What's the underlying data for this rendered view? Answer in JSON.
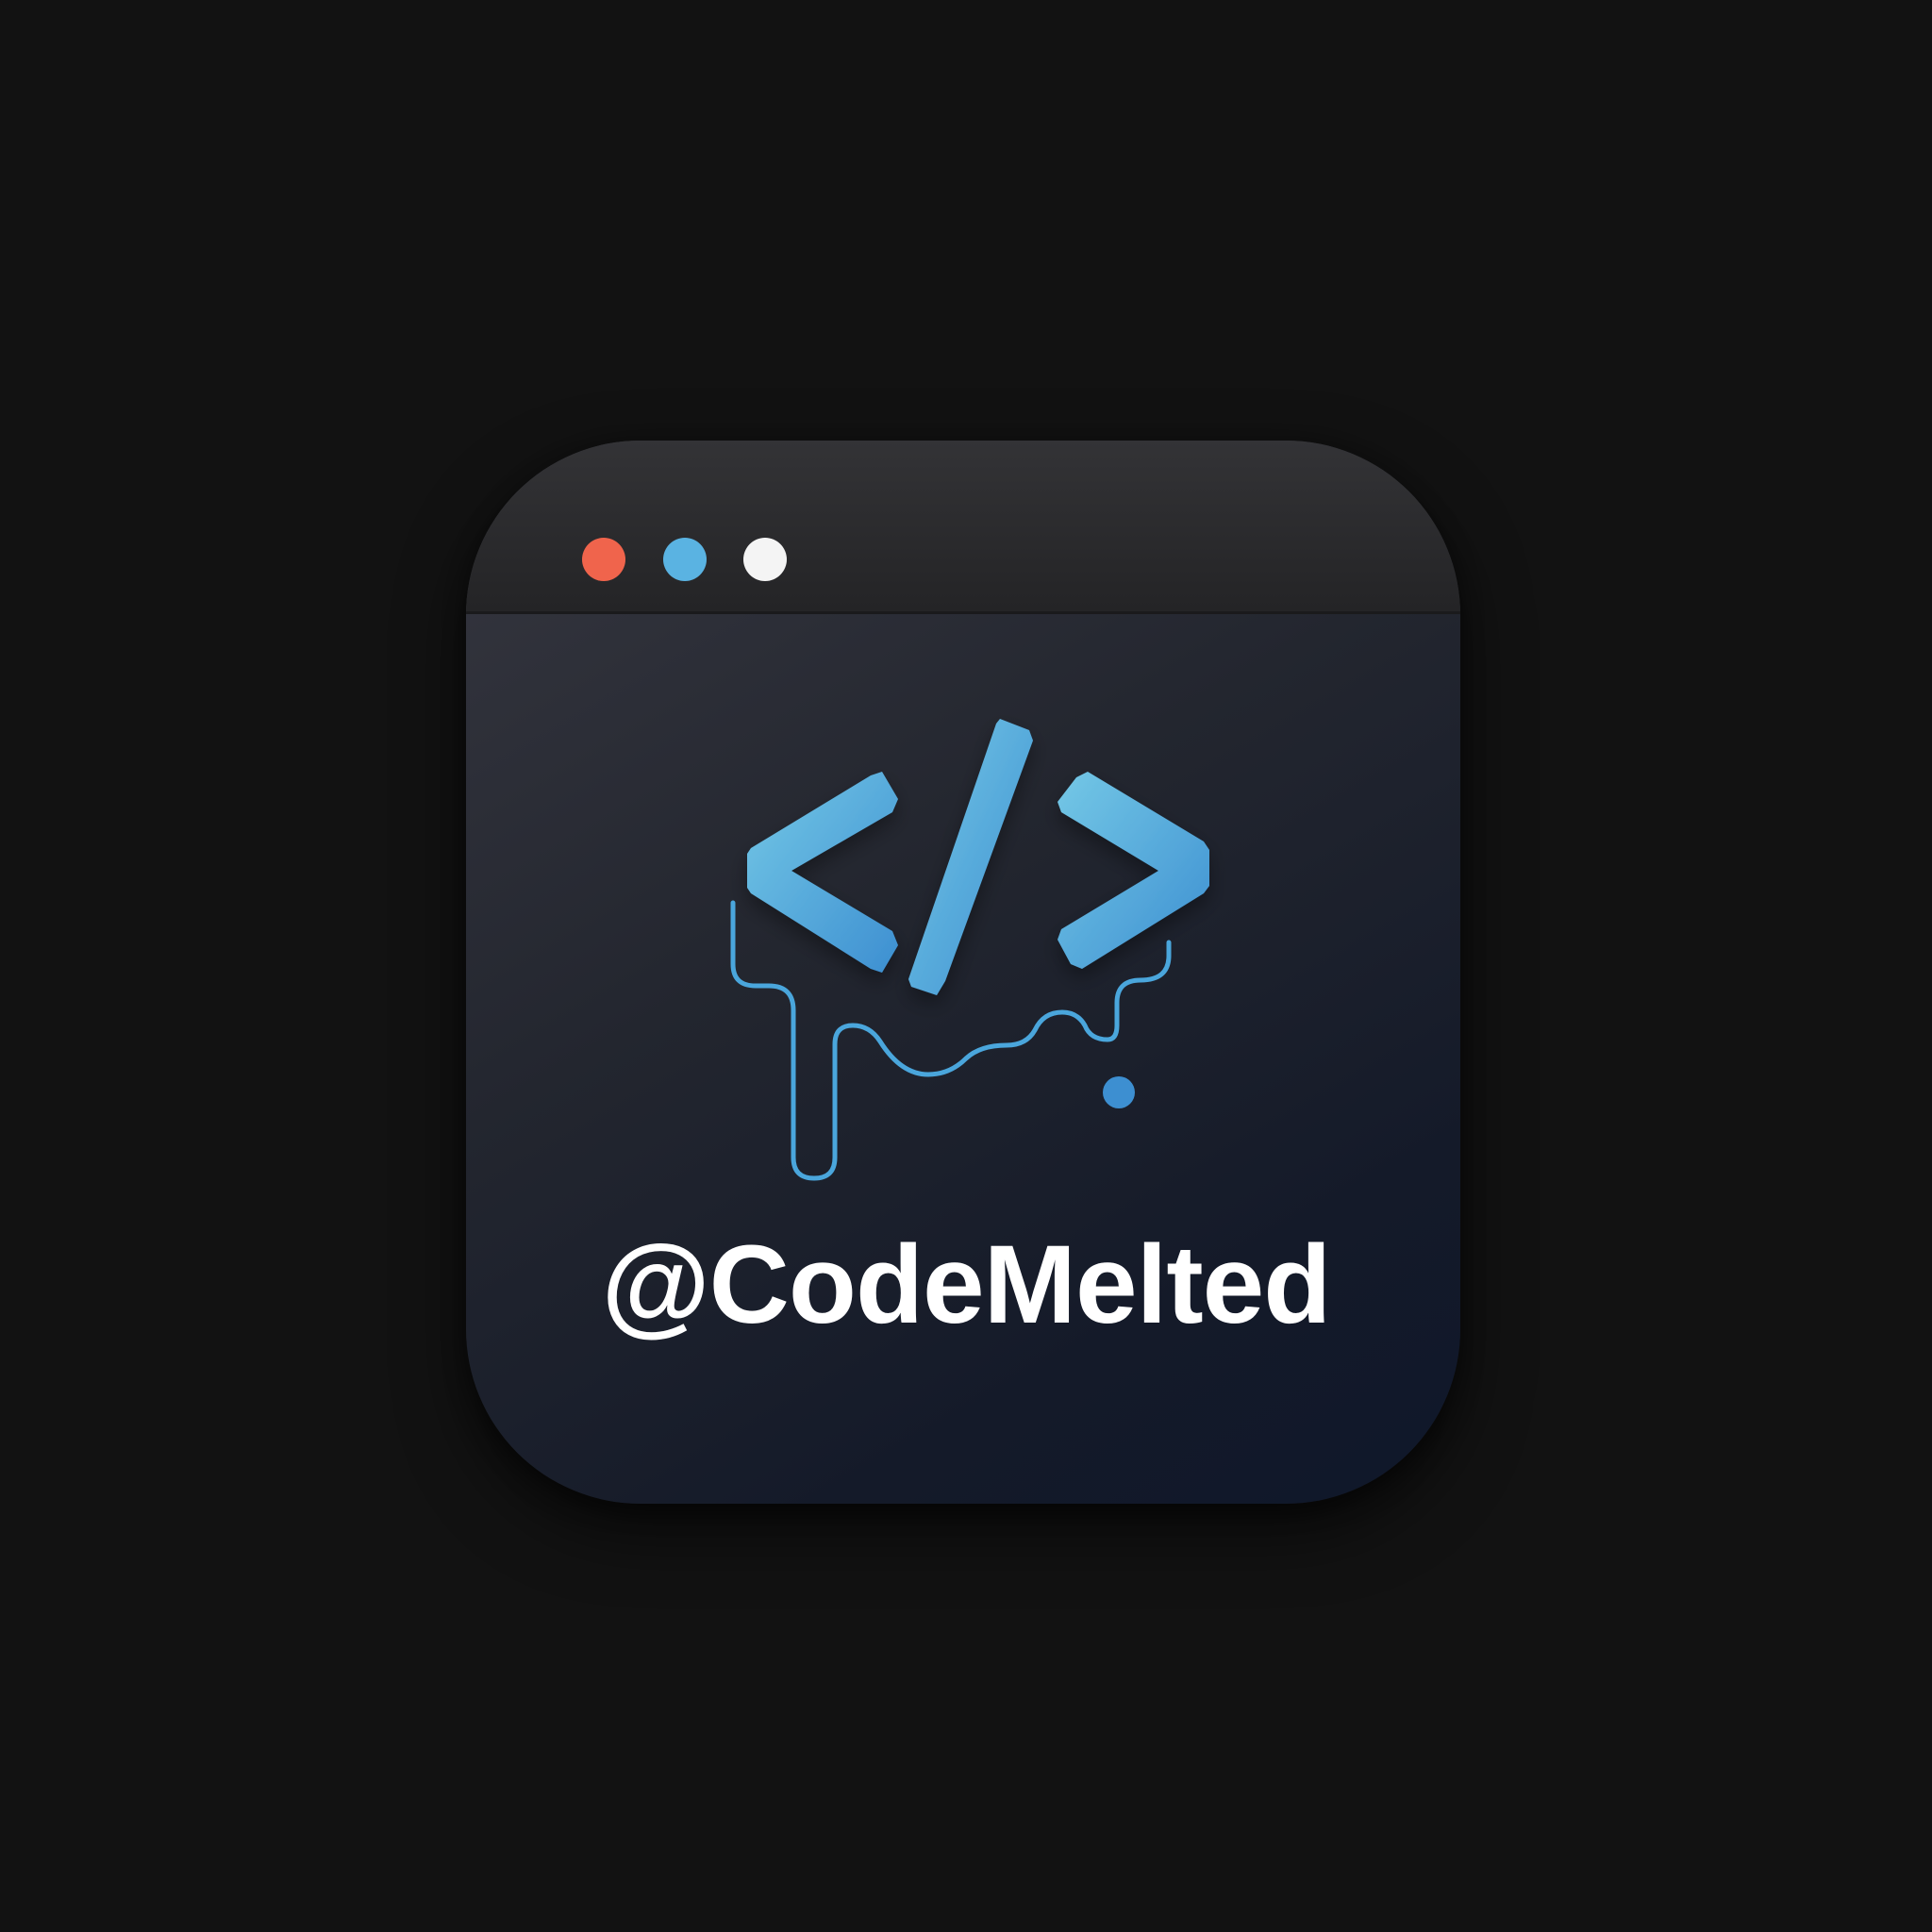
{
  "app": {
    "handle": "@CodeMelted",
    "logo_icon": "melting-code-tag-icon"
  },
  "window_controls": [
    "close-dot",
    "minimize-dot",
    "maximize-dot"
  ],
  "colors": {
    "background": "#121212",
    "accent_blue": "#5ab3e2",
    "close_dot": "#f0644c",
    "text": "#ffffff"
  }
}
